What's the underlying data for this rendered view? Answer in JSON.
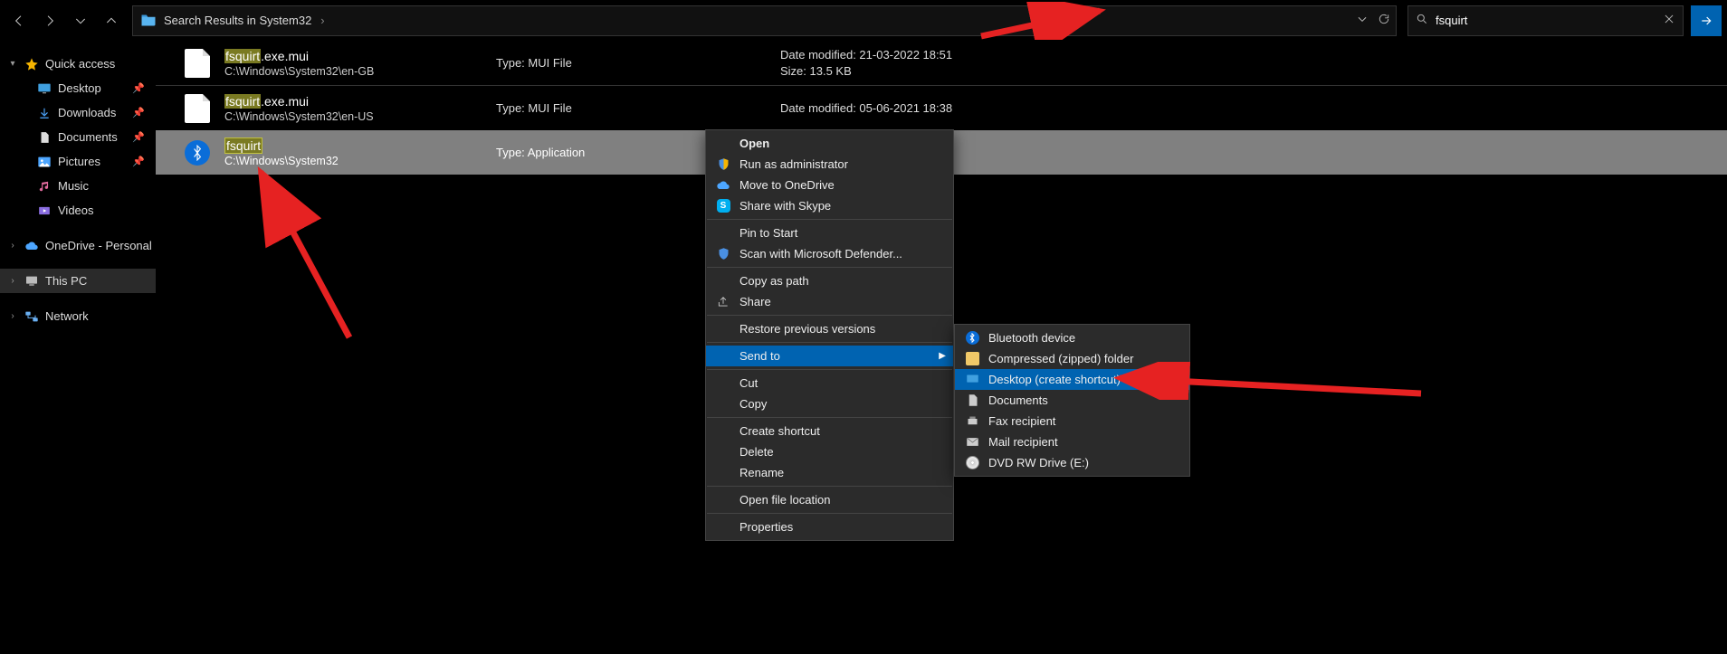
{
  "toolbar": {
    "breadcrumb": "Search Results in System32",
    "search_value": "fsquirt"
  },
  "sidebar": {
    "quick_access": "Quick access",
    "desktop": "Desktop",
    "downloads": "Downloads",
    "documents": "Documents",
    "pictures": "Pictures",
    "music": "Music",
    "videos": "Videos",
    "onedrive": "OneDrive - Personal",
    "this_pc": "This PC",
    "network": "Network"
  },
  "results": [
    {
      "name_hl": "fsquirt",
      "name_rest": ".exe.mui",
      "path": "C:\\Windows\\System32\\en-GB",
      "type": "Type: MUI File",
      "date": "Date modified: 21-03-2022 18:51",
      "size": "Size: 13.5 KB"
    },
    {
      "name_hl": "fsquirt",
      "name_rest": ".exe.mui",
      "path": "C:\\Windows\\System32\\en-US",
      "type": "Type: MUI File",
      "date": "Date modified: 05-06-2021 18:38",
      "size": ""
    },
    {
      "name_hl": "fsquirt",
      "name_rest": "",
      "path": "C:\\Windows\\System32",
      "type": "Type: Application",
      "date": "",
      "size": ""
    }
  ],
  "ctx": {
    "open": "Open",
    "runadmin": "Run as administrator",
    "onedrive": "Move to OneDrive",
    "skype": "Share with Skype",
    "pin": "Pin to Start",
    "defender": "Scan with Microsoft Defender...",
    "copypath": "Copy as path",
    "share": "Share",
    "restore": "Restore previous versions",
    "sendto": "Send to",
    "cut": "Cut",
    "copy": "Copy",
    "shortcut": "Create shortcut",
    "delete": "Delete",
    "rename": "Rename",
    "openloc": "Open file location",
    "props": "Properties"
  },
  "sendto": {
    "bluetooth": "Bluetooth device",
    "zipped": "Compressed (zipped) folder",
    "desktop": "Desktop (create shortcut)",
    "documents": "Documents",
    "fax": "Fax recipient",
    "mail": "Mail recipient",
    "dvd": "DVD RW Drive (E:)"
  }
}
